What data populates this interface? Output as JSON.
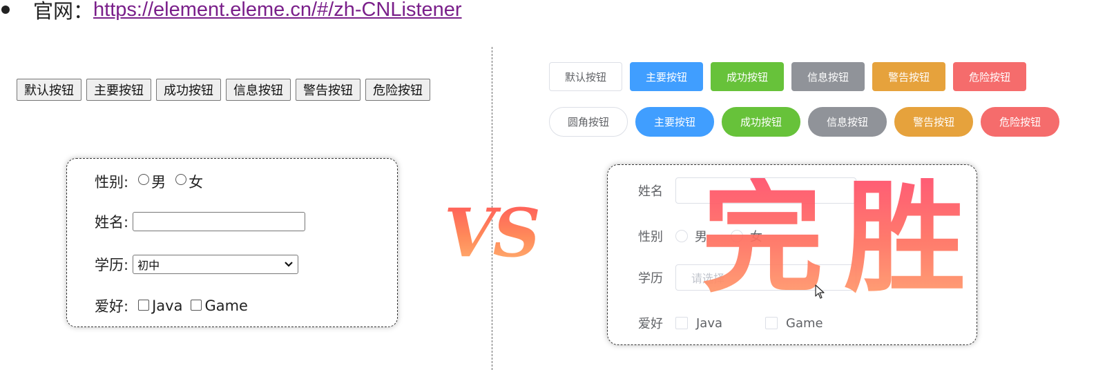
{
  "header": {
    "prefix": "官网：",
    "link_text": "https://element.eleme.cn/#/zh-CNListener"
  },
  "native": {
    "buttons": [
      "默认按钮",
      "主要按钮",
      "成功按钮",
      "信息按钮",
      "警告按钮",
      "危险按钮"
    ],
    "form": {
      "gender_label": "性别:",
      "gender_options": [
        "男",
        "女"
      ],
      "name_label": "姓名:",
      "name_value": "",
      "edu_label": "学历:",
      "edu_selected": "初中",
      "hobby_label": "爱好:",
      "hobby_options": [
        "Java",
        "Game"
      ]
    }
  },
  "vs_text": "VS",
  "element": {
    "buttons_row1": [
      "默认按钮",
      "主要按钮",
      "成功按钮",
      "信息按钮",
      "警告按钮",
      "危险按钮"
    ],
    "buttons_row2": [
      "圆角按钮",
      "主要按钮",
      "成功按钮",
      "信息按钮",
      "警告按钮",
      "危险按钮"
    ],
    "form": {
      "name_label": "姓名",
      "name_value": "",
      "gender_label": "性别",
      "gender_options": [
        "男",
        "女"
      ],
      "edu_label": "学历",
      "edu_placeholder": "请选择",
      "hobby_label": "爱好",
      "hobby_options": [
        "Java",
        "Game"
      ]
    }
  },
  "overlay_text": "完胜",
  "colors": {
    "primary": "#409eff",
    "success": "#67c23a",
    "info": "#909399",
    "warning": "#e6a23c",
    "danger": "#f56c6c",
    "link": "#7a1f8a"
  }
}
